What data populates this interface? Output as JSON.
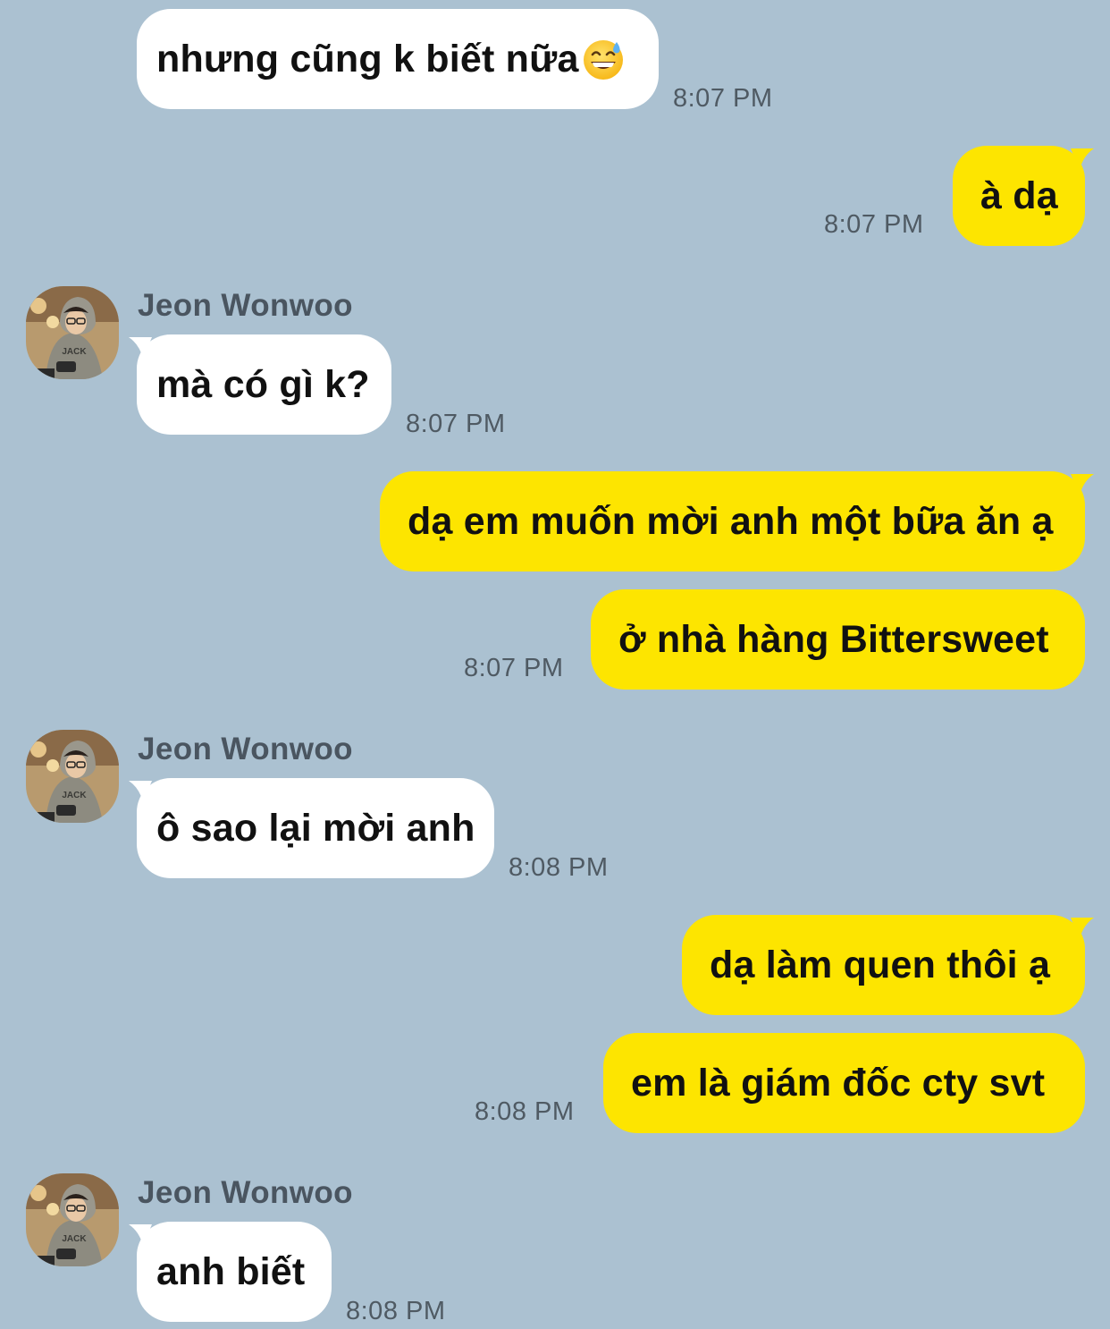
{
  "colors": {
    "background": "#abc1d1",
    "incoming_bubble": "#ffffff",
    "outgoing_bubble": "#fde500",
    "timestamp": "#4f5a63",
    "sender_name": "#4a5560"
  },
  "messages": [
    {
      "direction": "incoming",
      "text": "nhưng cũng k biết nữa",
      "emoji": "grinning-sweat-emoji",
      "time": "8:07 PM"
    },
    {
      "direction": "outgoing",
      "text": "à dạ",
      "time": "8:07 PM"
    },
    {
      "direction": "incoming",
      "sender": "Jeon Wonwoo",
      "text": "mà có gì k?",
      "time": "8:07 PM"
    },
    {
      "direction": "outgoing",
      "text": "dạ em muốn mời anh một bữa ăn ạ"
    },
    {
      "direction": "outgoing",
      "text": "ở nhà hàng Bittersweet",
      "time": "8:07 PM"
    },
    {
      "direction": "incoming",
      "sender": "Jeon Wonwoo",
      "text": "ô sao lại mời anh",
      "time": "8:08 PM"
    },
    {
      "direction": "outgoing",
      "text": "dạ làm quen thôi ạ"
    },
    {
      "direction": "outgoing",
      "text": "em là giám đốc cty svt",
      "time": "8:08 PM"
    },
    {
      "direction": "incoming",
      "sender": "Jeon Wonwoo",
      "text": "anh biết",
      "time": "8:08 PM"
    }
  ]
}
